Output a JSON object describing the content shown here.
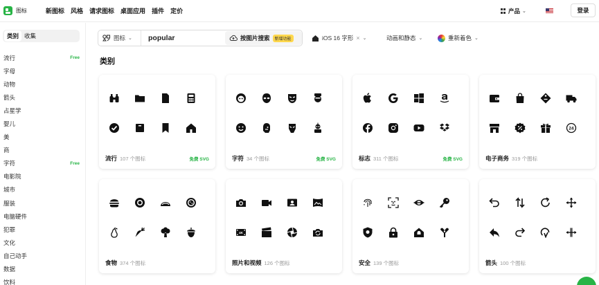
{
  "brand": {
    "name": "图标"
  },
  "nav": [
    "新图标",
    "风格",
    "请求图标",
    "桌面应用",
    "插件",
    "定价"
  ],
  "topright": {
    "product": "产品",
    "login": "登录"
  },
  "sidebar": {
    "tabs": [
      "类别",
      "收集"
    ],
    "items": [
      {
        "label": "流行",
        "badge": "Free"
      },
      {
        "label": "字母",
        "badge": ""
      },
      {
        "label": "动物",
        "badge": ""
      },
      {
        "label": "箭头",
        "badge": ""
      },
      {
        "label": "占星学",
        "badge": ""
      },
      {
        "label": "婴儿",
        "badge": ""
      },
      {
        "label": "美",
        "badge": ""
      },
      {
        "label": "商",
        "badge": ""
      },
      {
        "label": "字符",
        "badge": "Free"
      },
      {
        "label": "电影院",
        "badge": ""
      },
      {
        "label": "城市",
        "badge": ""
      },
      {
        "label": "服装",
        "badge": ""
      },
      {
        "label": "电脑硬件",
        "badge": ""
      },
      {
        "label": "犯罪",
        "badge": ""
      },
      {
        "label": "文化",
        "badge": ""
      },
      {
        "label": "自己动手",
        "badge": ""
      },
      {
        "label": "数据",
        "badge": ""
      },
      {
        "label": "饮料",
        "badge": ""
      }
    ]
  },
  "search": {
    "type_label": "图标",
    "query": "popular",
    "image_search_label": "按图片搜索",
    "new_badge": "新增功能"
  },
  "filters": {
    "style": "iOS 16 字形",
    "motion": "动画和静态",
    "recolor": "重新着色"
  },
  "section_title": "类别",
  "cards": [
    {
      "name": "流行",
      "count": "107 个图标",
      "free": "免费 SVG",
      "icons": [
        "binoculars-icon",
        "folder-icon",
        "document-icon",
        "calculator-icon",
        "checkmark-circle-icon",
        "box-icon",
        "bookmark-icon",
        "home-icon"
      ]
    },
    {
      "name": "字符",
      "count": "34 个图标",
      "free": "免费 SVG",
      "icons": [
        "avatar-face-icon",
        "alien-head-icon",
        "mask-icon",
        "bearded-man-icon",
        "smiling-face-icon",
        "bald-head-icon",
        "iron-mask-icon",
        "robot-icon"
      ]
    },
    {
      "name": "标志",
      "count": "311 个图标",
      "free": "免费 SVG",
      "icons": [
        "apple-logo-icon",
        "google-logo-icon",
        "windows-logo-icon",
        "amazon-logo-icon",
        "facebook-logo-icon",
        "instagram-logo-icon",
        "youtube-logo-icon",
        "dropbox-logo-icon"
      ]
    },
    {
      "name": "电子商务",
      "count": "319 个图标",
      "free": "",
      "icons": [
        "wallet-icon",
        "shopping-bag-icon",
        "price-tag-icon",
        "delivery-truck-icon",
        "store-icon",
        "discount-badge-icon",
        "gift-icon",
        "24-hour-service-icon"
      ]
    },
    {
      "name": "食物",
      "count": "374 个图标",
      "free": "",
      "icons": [
        "burger-icon",
        "plate-icon",
        "taco-icon",
        "pizza-icon",
        "pear-icon",
        "carrot-icon",
        "broccoli-icon",
        "acorn-icon"
      ]
    },
    {
      "name": "照片和视频",
      "count": "126 个图标",
      "free": "",
      "icons": [
        "camera-icon",
        "video-camera-icon",
        "photo-id-icon",
        "panorama-icon",
        "4k-film-icon",
        "clapperboard-icon",
        "aperture-icon",
        "switch-camera-icon"
      ]
    },
    {
      "name": "安全",
      "count": "139 个图标",
      "free": "",
      "icons": [
        "fingerprint-icon",
        "face-scan-icon",
        "eye-scan-icon",
        "key-icon",
        "shield-icon",
        "padlock-icon",
        "home-alarm-icon",
        "satellite-icon"
      ]
    },
    {
      "name": "箭头",
      "count": "100 个图标",
      "free": "",
      "icons": [
        "undo-arrow-icon",
        "swap-arrows-icon",
        "rotate-arrow-icon",
        "move-arrows-icon",
        "reply-arrow-icon",
        "redo-arrow-icon",
        "loop-arrow-icon",
        "resize-arrows-icon"
      ]
    }
  ]
}
